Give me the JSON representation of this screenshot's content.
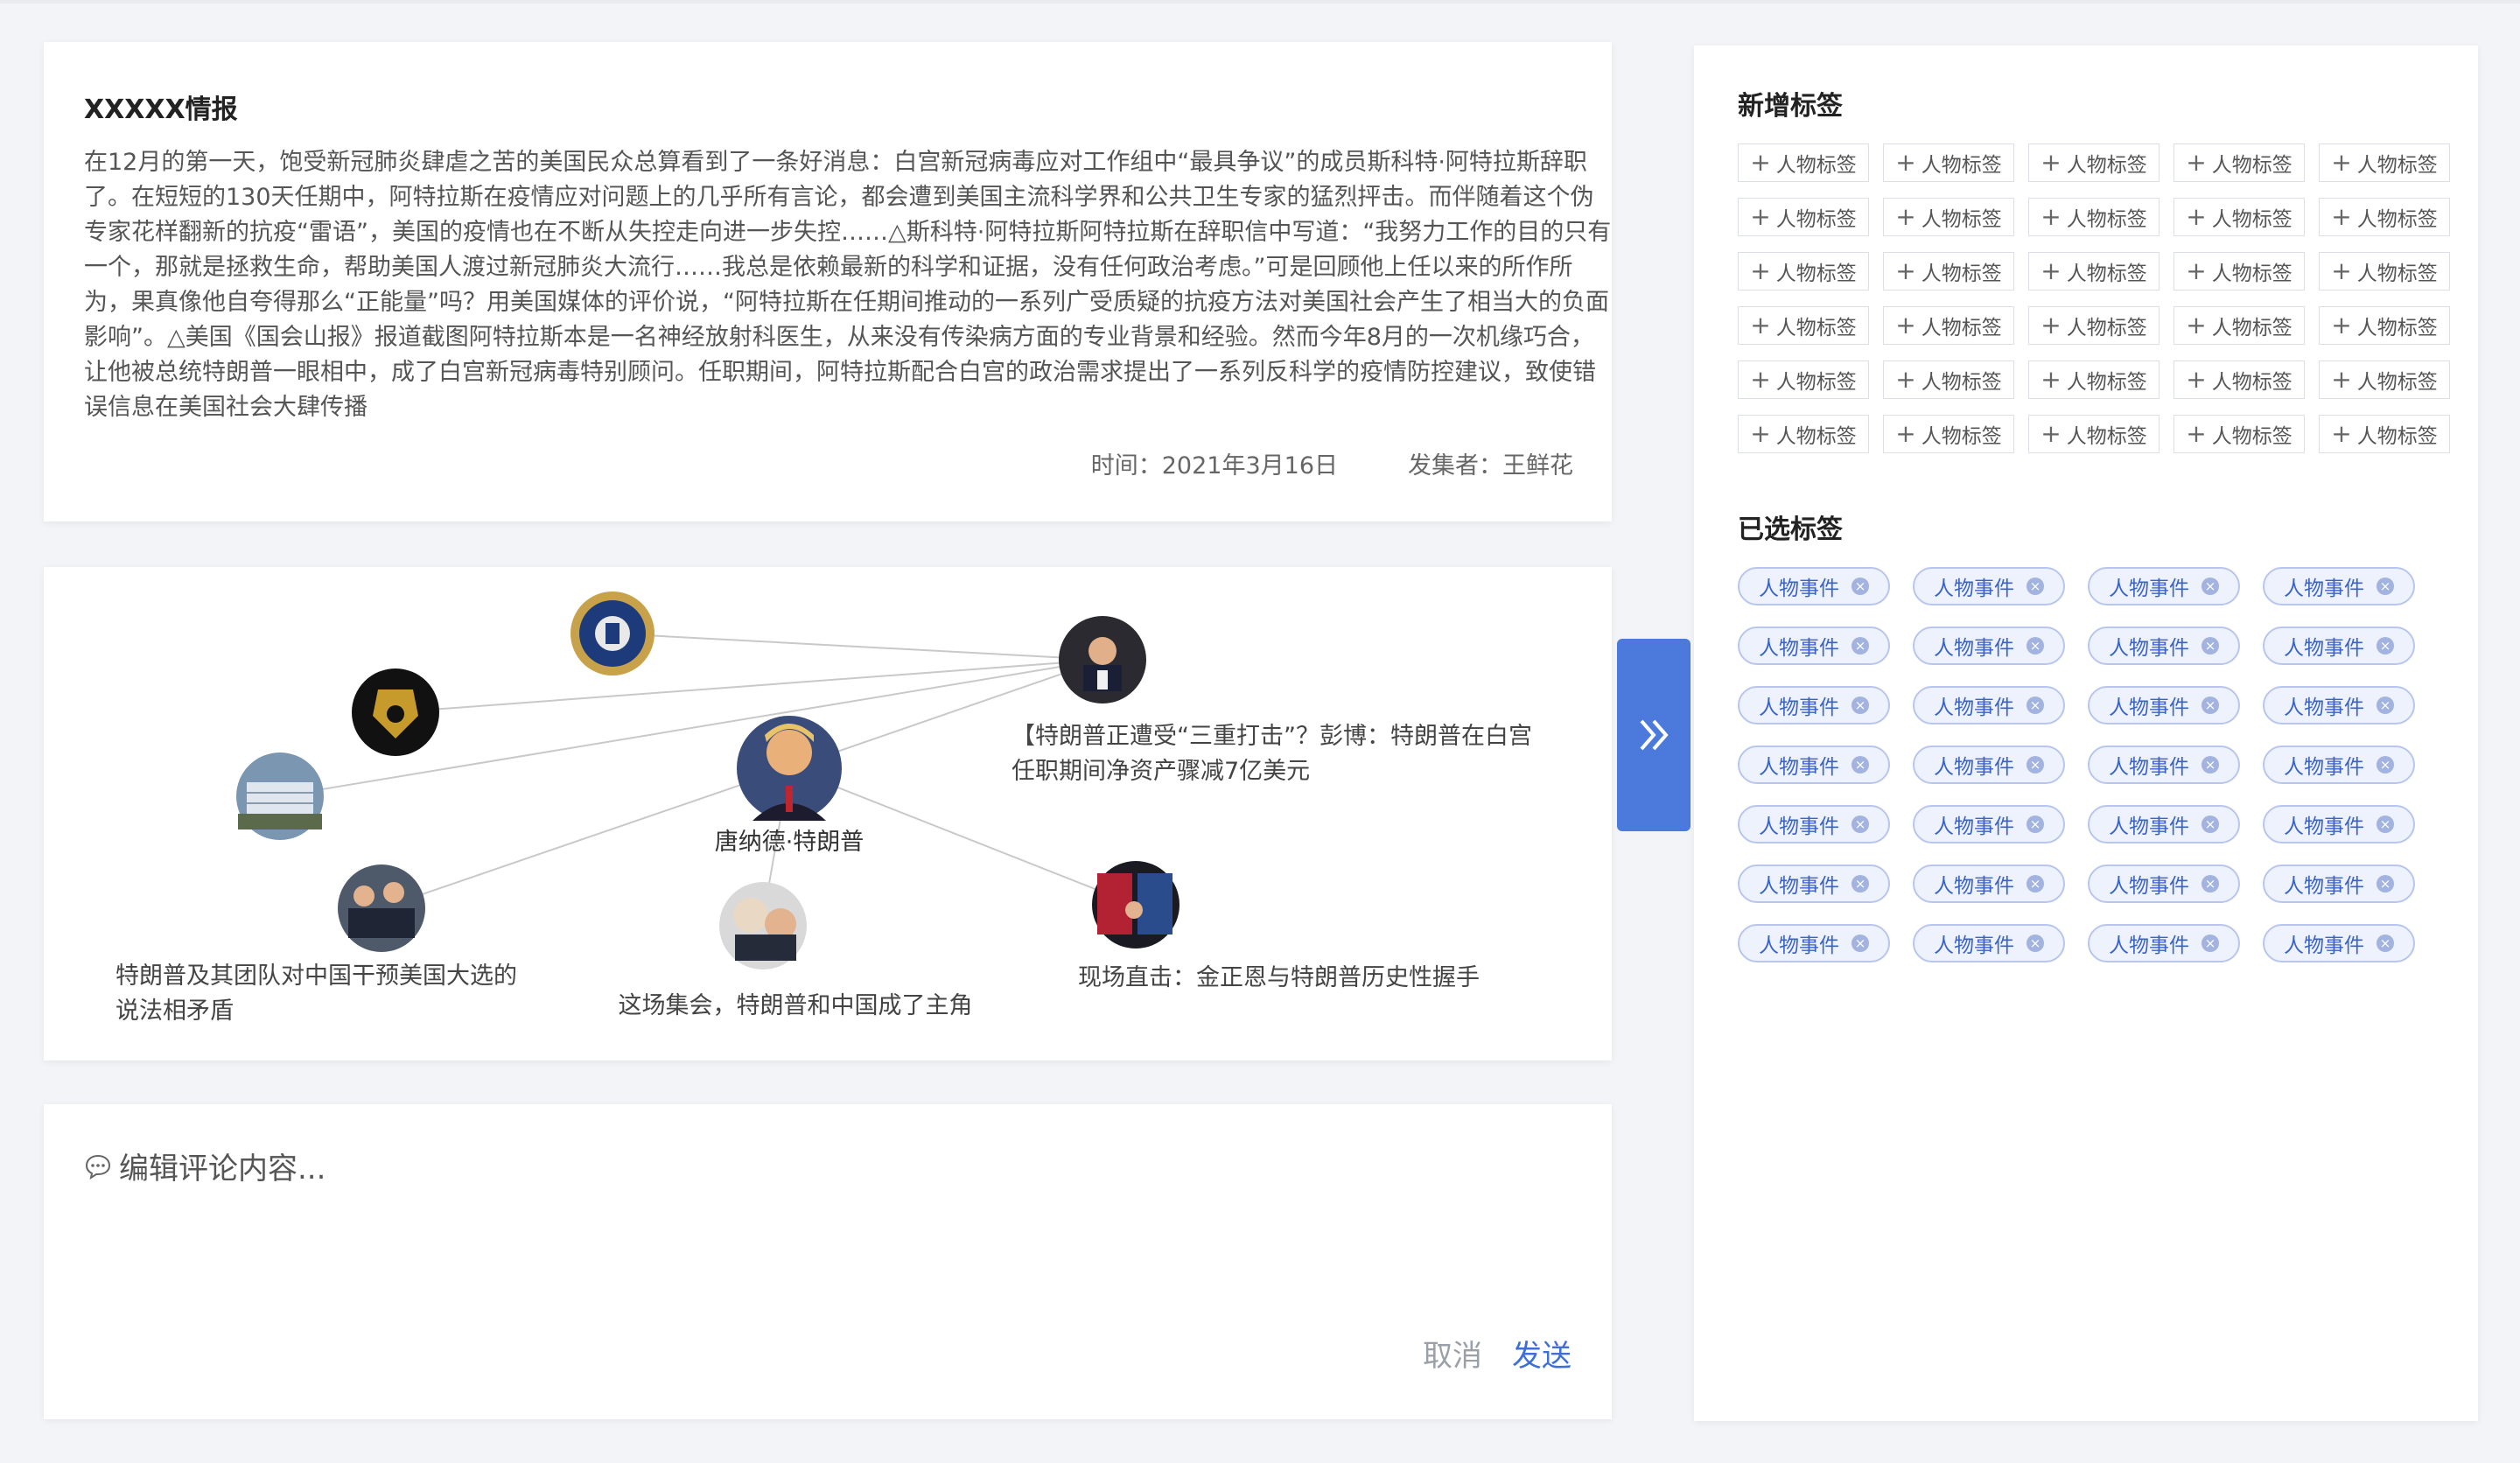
{
  "intel": {
    "title": "XXXXX情报",
    "body": "在12月的第一天，饱受新冠肺炎肆虐之苦的美国民众总算看到了一条好消息：白宫新冠病毒应对工作组中“最具争议”的成员斯科特·阿特拉斯辞职了。在短短的130天任期中，阿特拉斯在疫情应对问题上的几乎所有言论，都会遭到美国主流科学界和公共卫生专家的猛烈抨击。而伴随着这个伪专家花样翻新的抗疫“雷语”，美国的疫情也在不断从失控走向进一步失控……△斯科特·阿特拉斯阿特拉斯在辞职信中写道：“我努力工作的目的只有一个，那就是拯救生命，帮助美国人渡过新冠肺炎大流行……我总是依赖最新的科学和证据，没有任何政治考虑。”可是回顾他上任以来的所作所为，果真像他自夸得那么“正能量”吗？用美国媒体的评价说，“阿特拉斯在任期间推动的一系列广受质疑的抗疫方法对美国社会产生了相当大的负面影响”。△美国《国会山报》报道截图阿特拉斯本是一名神经放射科医生，从来没有传染病方面的专业背景和经验。然而今年8月的一次机缘巧合，让他被总统特朗普一眼相中，成了白宫新冠病毒特别顾问。任职期间，阿特拉斯配合白宫的政治需求提出了一系列反科学的疫情防控建议，致使错误信息在美国社会大肆传播",
    "time": "时间：2021年3月16日",
    "collector": "发集者：王鲜花"
  },
  "graph": {
    "center_label": "唐纳德·特朗普",
    "nodes": [
      {
        "name": "fbi-seal",
        "label": ""
      },
      {
        "name": "fbi-badge",
        "label": ""
      },
      {
        "name": "building",
        "label": ""
      },
      {
        "name": "trump-news-top",
        "label_line1": "【特朗普正遭受“三重打击”？彭博：特朗普在白宫",
        "label_line2": "任职期间净资产骤减7亿美元"
      },
      {
        "name": "team",
        "label_line1": "特朗普及其团队对中国干预美国大选的",
        "label_line2": "说法相矛盾"
      },
      {
        "name": "rally",
        "label": "这场集会，特朗普和中国成了主角"
      },
      {
        "name": "handshake",
        "label": "现场直击：金正恩与特朗普历史性握手"
      }
    ]
  },
  "toggle": {
    "icon": "double-chevron-right-icon"
  },
  "comment": {
    "placeholder": "编辑评论内容...",
    "cancel": "取消",
    "send": "发送"
  },
  "tags": {
    "new_title": "新增标签",
    "selected_title": "已选标签",
    "new_items": [
      "人物标签",
      "人物标签",
      "人物标签",
      "人物标签",
      "人物标签",
      "人物标签",
      "人物标签",
      "人物标签",
      "人物标签",
      "人物标签",
      "人物标签",
      "人物标签",
      "人物标签",
      "人物标签",
      "人物标签",
      "人物标签",
      "人物标签",
      "人物标签",
      "人物标签",
      "人物标签",
      "人物标签",
      "人物标签",
      "人物标签",
      "人物标签",
      "人物标签",
      "人物标签",
      "人物标签",
      "人物标签",
      "人物标签",
      "人物标签"
    ],
    "selected_items": [
      "人物事件",
      "人物事件",
      "人物事件",
      "人物事件",
      "人物事件",
      "人物事件",
      "人物事件",
      "人物事件",
      "人物事件",
      "人物事件",
      "人物事件",
      "人物事件",
      "人物事件",
      "人物事件",
      "人物事件",
      "人物事件",
      "人物事件",
      "人物事件",
      "人物事件",
      "人物事件",
      "人物事件",
      "人物事件",
      "人物事件",
      "人物事件",
      "人物事件",
      "人物事件",
      "人物事件",
      "人物事件"
    ]
  },
  "colors": {
    "accent": "#4b79dc",
    "tag_border": "#b8c6ef",
    "tag_bg": "#eef2fc"
  }
}
